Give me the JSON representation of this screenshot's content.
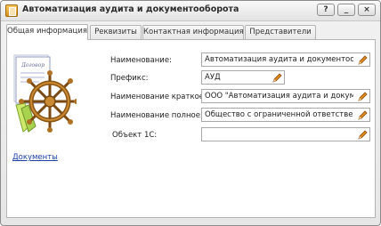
{
  "window": {
    "title": "Автоматизация аудита и документооборота",
    "buttons": [
      "?",
      "_",
      "×"
    ]
  },
  "tabs": [
    {
      "label": "Общая информация",
      "active": true
    },
    {
      "label": "Реквизиты",
      "active": false
    },
    {
      "label": "Контактная информация",
      "active": false
    },
    {
      "label": "Представители",
      "active": false
    }
  ],
  "illustration": {
    "document_label": "Договор",
    "icon": "ship-wheel-document-icon"
  },
  "form": {
    "name_label": "Наименование:",
    "name_value": "Автоматизация аудита и документооборота",
    "prefix_label": "Префикс:",
    "prefix_value": "АУД",
    "short_name_label": "Наименование краткое:",
    "short_name_value": "ООО \"Автоматизация аудита и документооборота\"",
    "full_name_label": "Наименование полное:",
    "full_name_value": "Общество с ограниченной ответственностью",
    "object_1c_label": "Объект 1С:",
    "object_1c_value": ""
  },
  "documents_link": "Документы",
  "colors": {
    "link": "#1a3fa8",
    "pencil": "#e08a1e"
  }
}
